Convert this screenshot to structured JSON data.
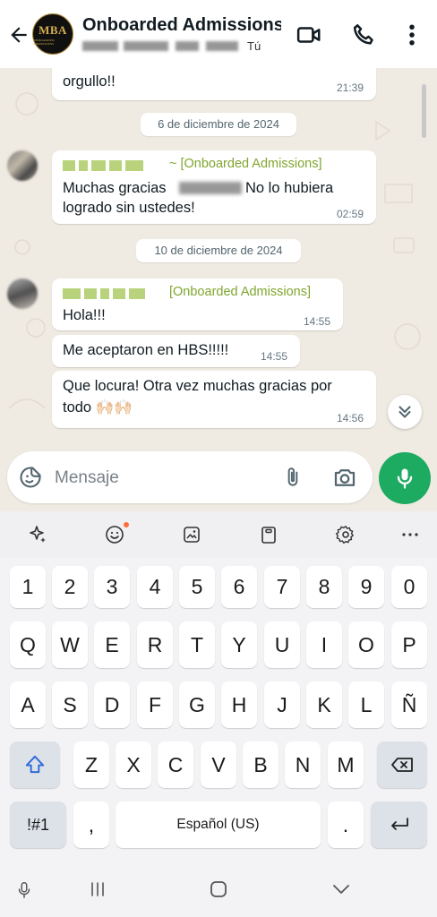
{
  "header": {
    "title": "Onboarded Admissions...",
    "subtitle_suffix": "Tú",
    "avatar": {
      "text": "MBA",
      "subtext": "ONBOARDED ADMISSIONS"
    }
  },
  "chat": {
    "messages": [
      {
        "text": "orgullo!!",
        "time": "21:39"
      },
      {
        "date": "6 de diciembre de 2024"
      },
      {
        "sender": "~ [Onboarded Admissions]",
        "text_line1": "Muchas gracias",
        "text_line1b": "No lo hubiera",
        "text_line2": "logrado sin ustedes!",
        "time": "02:59"
      },
      {
        "date": "10 de diciembre de 2024"
      },
      {
        "sender": "[Onboarded Admissions]",
        "text": "Hola!!!",
        "time": "14:55"
      },
      {
        "text": "Me aceptaron en HBS!!!!!",
        "time": "14:55"
      },
      {
        "text_line1": "Que locura! Otra vez muchas gracias por",
        "text_line2": "todo 🙌🏻🙌🏻",
        "time": "14:56"
      }
    ]
  },
  "composer": {
    "placeholder": "Mensaje"
  },
  "keyboard": {
    "row_numbers": [
      "1",
      "2",
      "3",
      "4",
      "5",
      "6",
      "7",
      "8",
      "9",
      "0"
    ],
    "row1": [
      "Q",
      "W",
      "E",
      "R",
      "T",
      "Y",
      "U",
      "I",
      "O",
      "P"
    ],
    "row2": [
      "A",
      "S",
      "D",
      "F",
      "G",
      "H",
      "J",
      "K",
      "L",
      "Ñ"
    ],
    "row3": [
      "Z",
      "X",
      "C",
      "V",
      "B",
      "N",
      "M"
    ],
    "symbols": "!#1",
    "comma": ",",
    "space": "Español (US)",
    "period": "."
  },
  "colors": {
    "accent_green": "#1daa61",
    "sender_green": "#7ea62d",
    "chat_bg": "#efeae2"
  }
}
